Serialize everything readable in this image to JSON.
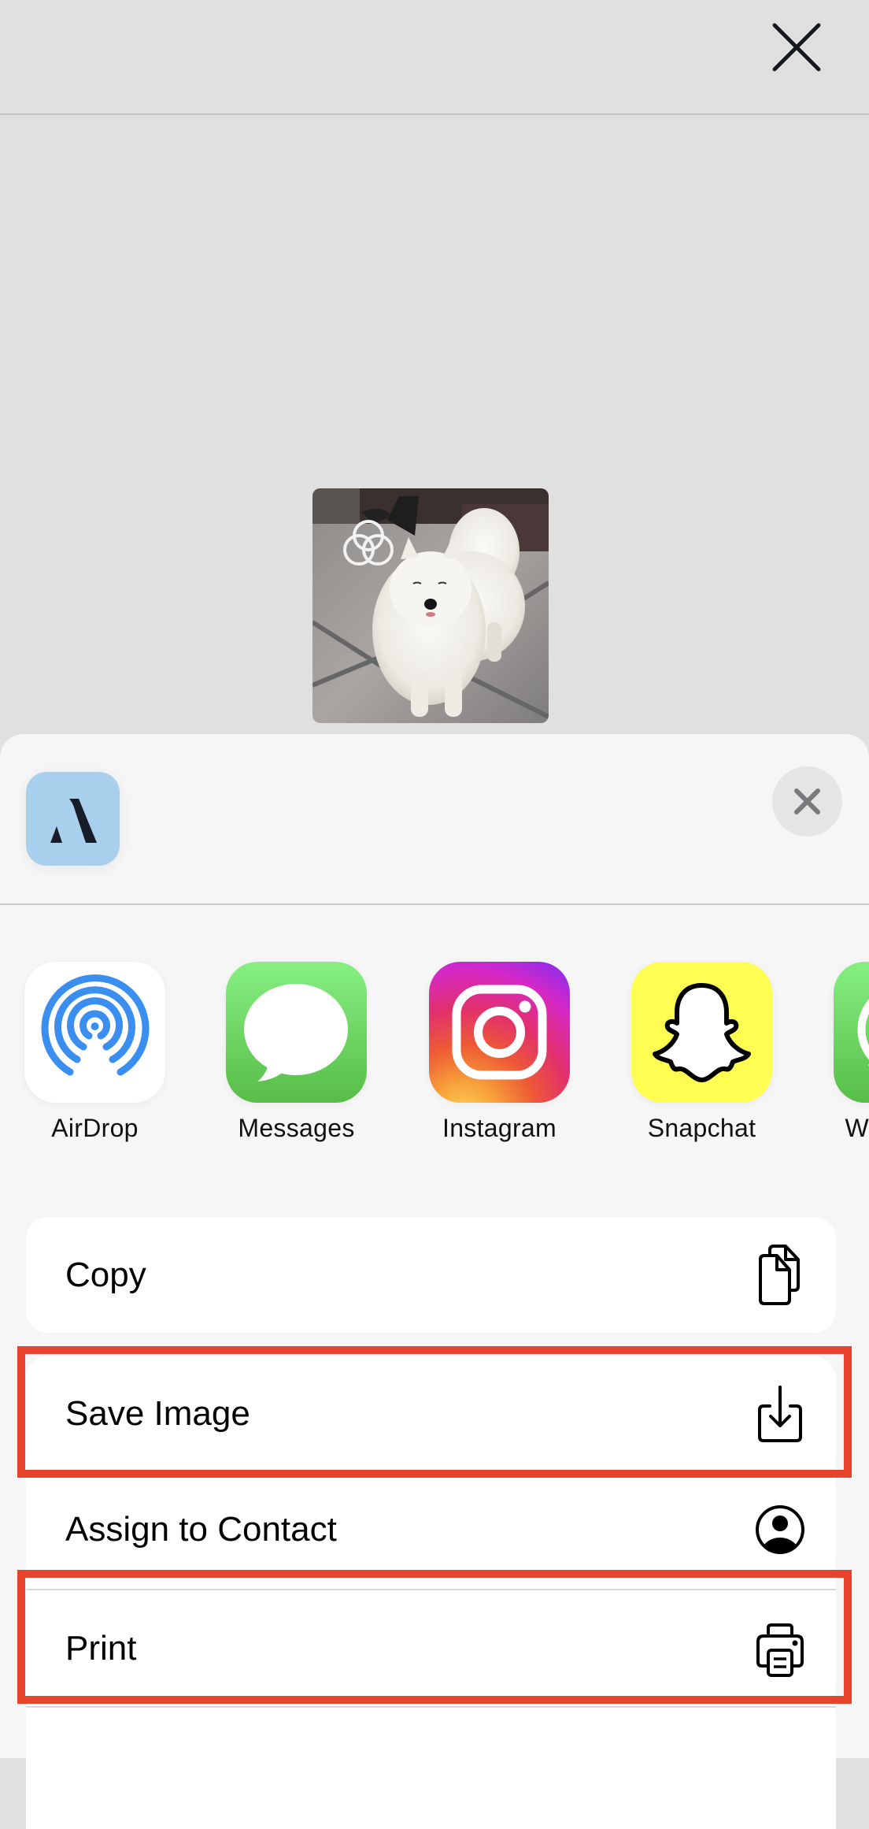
{
  "top_bar": {
    "close_icon": "close-icon"
  },
  "preview": {
    "subject": "white Samoyed dog on tiled floor",
    "badge_icon": "live-photo-icon"
  },
  "sheet": {
    "app_icon": {
      "name": "app-icon",
      "glyph": "A",
      "bg": "#a8cfec",
      "fg": "#161d29"
    },
    "close_icon": "close-icon"
  },
  "share_targets": [
    {
      "label": "AirDrop",
      "icon": "airdrop-icon"
    },
    {
      "label": "Messages",
      "icon": "messages-icon"
    },
    {
      "label": "Instagram",
      "icon": "instagram-icon"
    },
    {
      "label": "Snapchat",
      "icon": "snapchat-icon"
    },
    {
      "label": "WhatsApp",
      "icon": "whatsapp-icon"
    }
  ],
  "actions": [
    {
      "label": "Copy",
      "icon": "copy-icon",
      "highlighted": false
    },
    {
      "label": "Save Image",
      "icon": "save-image-icon",
      "highlighted": true
    },
    {
      "label": "Assign to Contact",
      "icon": "contact-icon",
      "highlighted": false
    },
    {
      "label": "Print",
      "icon": "printer-icon",
      "highlighted": true
    }
  ],
  "colors": {
    "highlight": "#e8432c",
    "background": "#e0e0e0",
    "sheet": "#f6f6f6",
    "airdrop_blue": "#3a8ef0",
    "messages_green": "#5bc24c",
    "snapchat_yellow": "#fffc52"
  }
}
